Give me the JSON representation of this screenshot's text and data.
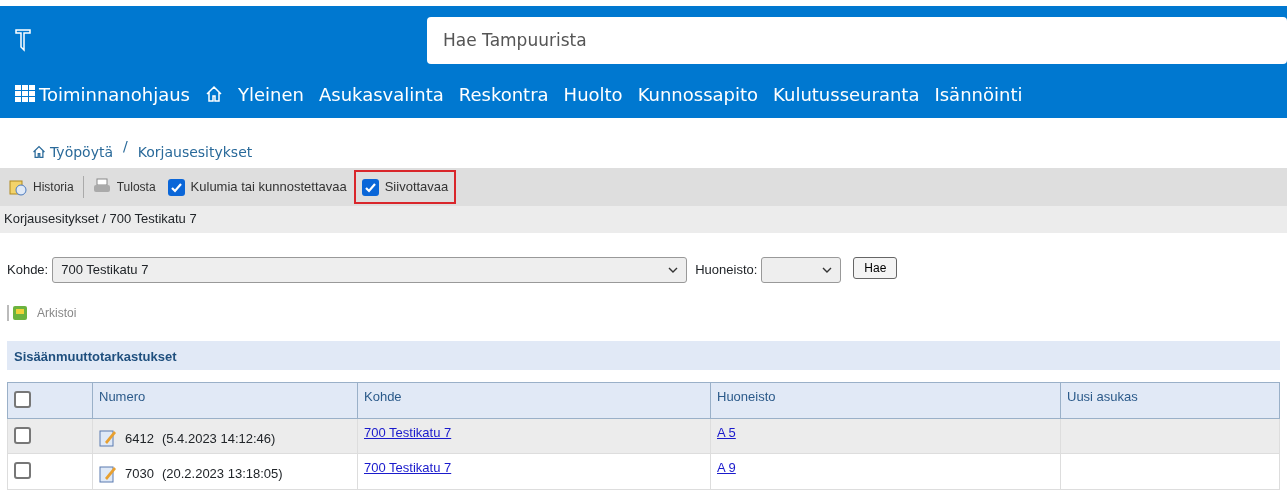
{
  "header": {
    "search": {
      "placeholder": "Hae Tampuurista"
    },
    "nav": [
      {
        "label": "Toiminnanohjaus",
        "kind": "grid"
      },
      {
        "kind": "home"
      },
      {
        "label": "Yleinen",
        "kind": "text"
      },
      {
        "label": "Asukasvalinta",
        "kind": "text"
      },
      {
        "label": "Reskontra",
        "kind": "text"
      },
      {
        "label": "Huolto",
        "kind": "text"
      },
      {
        "label": "Kunnossapito",
        "kind": "text"
      },
      {
        "label": "Kulutusseuranta",
        "kind": "text"
      },
      {
        "label": "Isännöinti",
        "kind": "text"
      }
    ]
  },
  "breadcrumb": [
    "Työpöytä",
    "Korjausesitykset"
  ],
  "breadcrumb_separator": "/",
  "toolbar": [
    {
      "kind": "history",
      "label": "Historia"
    },
    {
      "kind": "print",
      "label": "Tulosta"
    },
    {
      "kind": "checkbox",
      "label": "Kulumia tai kunnostettavaa",
      "checked": true,
      "highlighted": false
    },
    {
      "kind": "checkbox",
      "label": "Siivottavaa",
      "checked": true,
      "highlighted": true
    }
  ],
  "path": "Korjausesitykset / 700 Testikatu 7",
  "filter": {
    "kohde_label": "Kohde:",
    "kohde_value": "700 Testikatu 7",
    "huoneisto_label": "Huoneisto:",
    "button": "Hae"
  },
  "archive": "Arkistoi",
  "section": "Sisäänmuuttotarkastukset",
  "table": {
    "header_checked": false,
    "columns": [
      "Numero",
      "Kohde",
      "Huoneisto",
      "Uusi asukas"
    ],
    "rows": [
      {
        "checked": false,
        "number": "6412",
        "date": "(5.4.2023 14:12:46)",
        "kohde": "700 Testikatu 7",
        "huoneisto": "A 5"
      },
      {
        "checked": false,
        "number": "7030",
        "date": "(20.2.2023 13:18:05)",
        "kohde": "700 Testikatu 7",
        "huoneisto": "A 9"
      }
    ]
  }
}
